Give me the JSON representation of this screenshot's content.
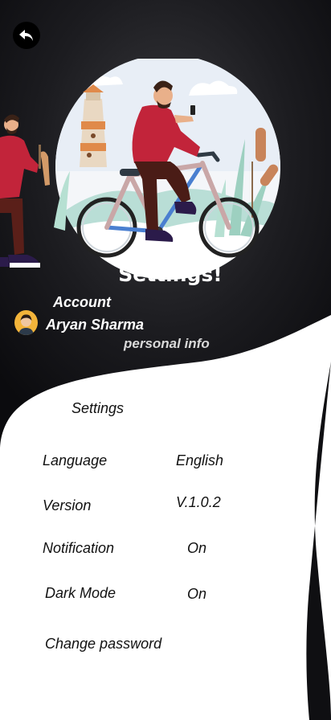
{
  "header": {
    "title": "Settings!"
  },
  "account": {
    "label": "Account",
    "name": "Aryan Sharma",
    "link": "personal info"
  },
  "settings": {
    "heading": "Settings",
    "rows": [
      {
        "label": "Language",
        "value": "English"
      },
      {
        "label": "Version",
        "value": "V.1.0.2"
      },
      {
        "label": "Notification",
        "value": "On"
      },
      {
        "label": "Dark Mode",
        "value": "On"
      },
      {
        "label": "Change password",
        "value": ""
      }
    ]
  },
  "icons": {
    "back": "back-arrow-icon",
    "avatar": "user-avatar"
  },
  "colors": {
    "dark_bg": "#141418",
    "accent_red": "#c2243a",
    "avatar_bg": "#f3b43a"
  }
}
